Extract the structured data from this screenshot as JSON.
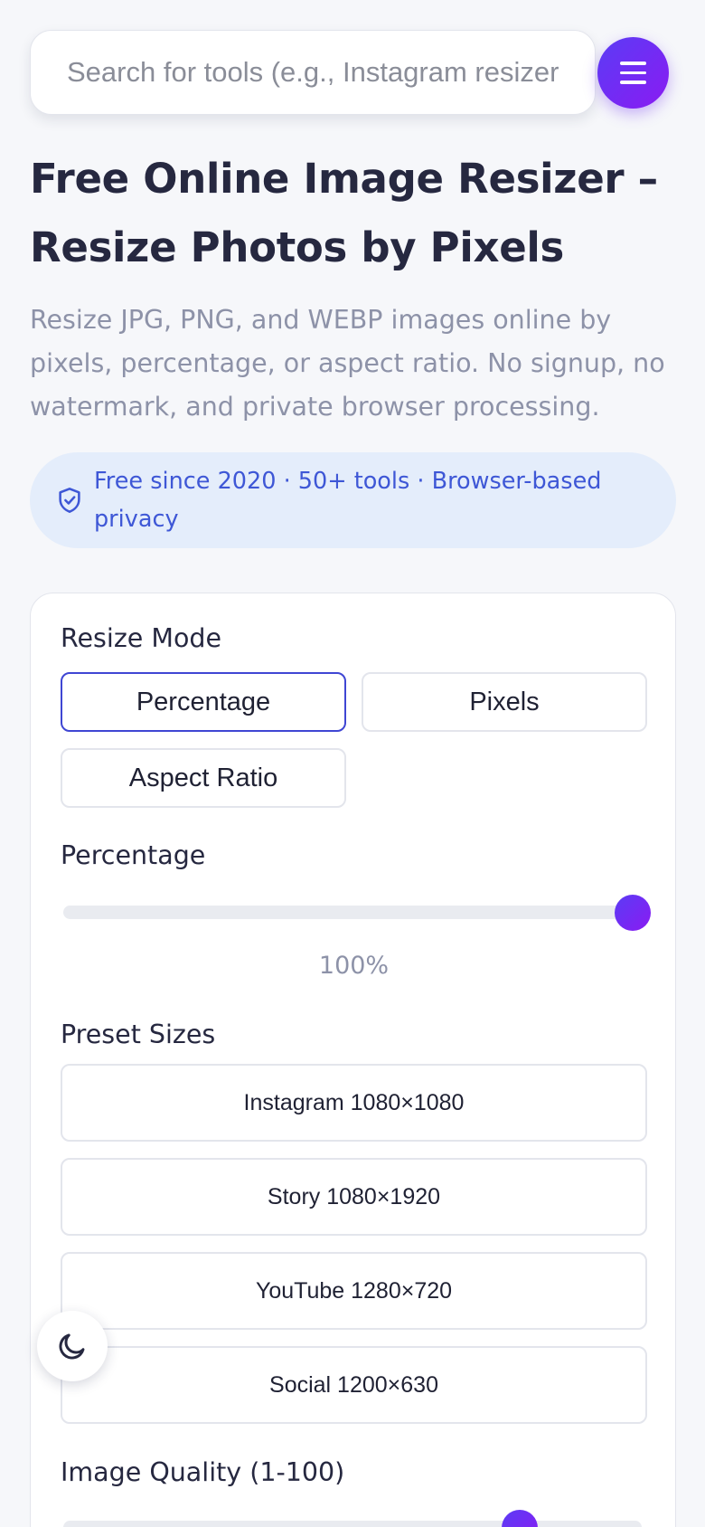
{
  "search": {
    "placeholder": "Search for tools (e.g., Instagram resizer"
  },
  "header": {
    "menu_icon": "hamburger-icon"
  },
  "hero": {
    "title_line1": "Free Online Image Resizer –",
    "title_line2": "Resize Photos by Pixels",
    "subtitle": "Resize JPG, PNG, and WEBP images online by pixels, percentage, or aspect ratio. No signup, no watermark, and private browser processing.",
    "badge_icon": "shield-check-icon",
    "badge_text": "Free since 2020 · 50+ tools · Browser-based privacy"
  },
  "resizer": {
    "mode_label": "Resize Mode",
    "modes": [
      {
        "label": "Percentage",
        "active": true
      },
      {
        "label": "Pixels",
        "active": false
      },
      {
        "label": "Aspect Ratio",
        "active": false
      }
    ],
    "percentage_label": "Percentage",
    "percentage_value": 100,
    "percentage_display": "100%",
    "presets_label": "Preset Sizes",
    "presets": [
      "Instagram 1080×1080",
      "Story 1080×1920",
      "YouTube 1280×720",
      "Social 1200×630"
    ],
    "quality_label": "Image Quality (1-100)",
    "quality_value": 80
  },
  "theme_toggle": {
    "icon": "moon-icon"
  },
  "colors": {
    "accent_start": "#5b3cf5",
    "accent_end": "#8a1bf2",
    "active_border": "#3f46d3",
    "badge_bg": "#e4edfb",
    "badge_text": "#3e57d6"
  }
}
